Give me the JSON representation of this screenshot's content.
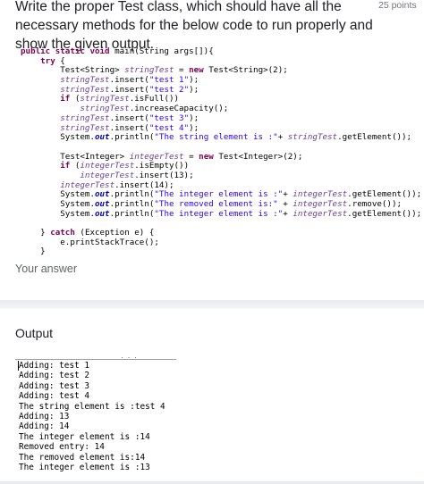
{
  "question": {
    "title": "Write the proper Test class, which should have all the necessary methods for the below code to run properly and show the given output.",
    "points": "25 points",
    "answer_label": "Your answer"
  },
  "code_lines": [
    [
      [
        "kw",
        "public static void "
      ],
      [
        "ty",
        "main(String args[]){"
      ]
    ],
    [
      [
        "kw",
        "    try "
      ],
      [
        "ty",
        "{"
      ]
    ],
    [
      [
        "ty",
        "        Test<String> "
      ],
      [
        "var",
        "stringTest"
      ],
      [
        "ty",
        " = "
      ],
      [
        "kw",
        "new "
      ],
      [
        "ty",
        "Test<String>(2);"
      ]
    ],
    [
      [
        "var",
        "        stringTest"
      ],
      [
        "ty",
        ".insert("
      ],
      [
        "str",
        "\"test 1\""
      ],
      [
        "ty",
        ");"
      ]
    ],
    [
      [
        "var",
        "        stringTest"
      ],
      [
        "ty",
        ".insert("
      ],
      [
        "str",
        "\"test 2\""
      ],
      [
        "ty",
        ");"
      ]
    ],
    [
      [
        "kw",
        "        if "
      ],
      [
        "ty",
        "("
      ],
      [
        "var",
        "stringTest"
      ],
      [
        "ty",
        ".isFull())"
      ]
    ],
    [
      [
        "var",
        "            stringTest"
      ],
      [
        "ty",
        ".increaseCapacity();"
      ]
    ],
    [
      [
        "var",
        "        stringTest"
      ],
      [
        "ty",
        ".insert("
      ],
      [
        "str",
        "\"test 3\""
      ],
      [
        "ty",
        ");"
      ]
    ],
    [
      [
        "var",
        "        stringTest"
      ],
      [
        "ty",
        ".insert("
      ],
      [
        "str",
        "\"test 4\""
      ],
      [
        "ty",
        ");"
      ]
    ],
    [
      [
        "ty",
        "        System."
      ],
      [
        "out",
        "out"
      ],
      [
        "ty",
        ".println("
      ],
      [
        "str",
        "\"The string element is :\""
      ],
      [
        "ty",
        "+ "
      ],
      [
        "var",
        "stringTest"
      ],
      [
        "ty",
        ".getElement());"
      ]
    ],
    [
      [
        "ty",
        ""
      ]
    ],
    [
      [
        "ty",
        "        Test<Integer> "
      ],
      [
        "var",
        "integerTest"
      ],
      [
        "ty",
        " = "
      ],
      [
        "kw",
        "new "
      ],
      [
        "ty",
        "Test<Integer>(2);"
      ]
    ],
    [
      [
        "kw",
        "        if "
      ],
      [
        "ty",
        "("
      ],
      [
        "var",
        "integerTest"
      ],
      [
        "ty",
        ".isEmpty())"
      ]
    ],
    [
      [
        "var",
        "            integerTest"
      ],
      [
        "ty",
        ".insert(13);"
      ]
    ],
    [
      [
        "var",
        "        integerTest"
      ],
      [
        "ty",
        ".insert(14);"
      ]
    ],
    [
      [
        "ty",
        "        System."
      ],
      [
        "out",
        "out"
      ],
      [
        "ty",
        ".println("
      ],
      [
        "str",
        "\"The integer element is :\""
      ],
      [
        "ty",
        "+ "
      ],
      [
        "var",
        "integerTest"
      ],
      [
        "ty",
        ".getElement());"
      ]
    ],
    [
      [
        "ty",
        "        System."
      ],
      [
        "out",
        "out"
      ],
      [
        "ty",
        ".println("
      ],
      [
        "str",
        "\"The removed element is:\""
      ],
      [
        "ty",
        " + "
      ],
      [
        "var",
        "integerTest"
      ],
      [
        "ty",
        ".remove());"
      ]
    ],
    [
      [
        "ty",
        "        System."
      ],
      [
        "out",
        "out"
      ],
      [
        "ty",
        ".println("
      ],
      [
        "str",
        "\"The integer element is :\""
      ],
      [
        "ty",
        "+ "
      ],
      [
        "var",
        "integerTest"
      ],
      [
        "ty",
        ".getElement());"
      ]
    ],
    [
      [
        "ty",
        ""
      ]
    ],
    [
      [
        "ty",
        "    } "
      ],
      [
        "kw",
        "catch "
      ],
      [
        "ty",
        "(Exception e) {"
      ]
    ],
    [
      [
        "ty",
        "        e.printStackTrace();"
      ]
    ],
    [
      [
        "ty",
        "    }"
      ]
    ]
  ],
  "output": {
    "heading": "Output",
    "dots": "· · ·",
    "lines": [
      "Adding: test 1",
      "Adding: test 2",
      "Adding: test 3",
      "Adding: test 4",
      "The string element is :test 4",
      "Adding: 13",
      "Adding: 14",
      "The integer element is :14",
      "Removed entry: 14",
      "The removed element is:14",
      "The integer element is :13"
    ]
  }
}
